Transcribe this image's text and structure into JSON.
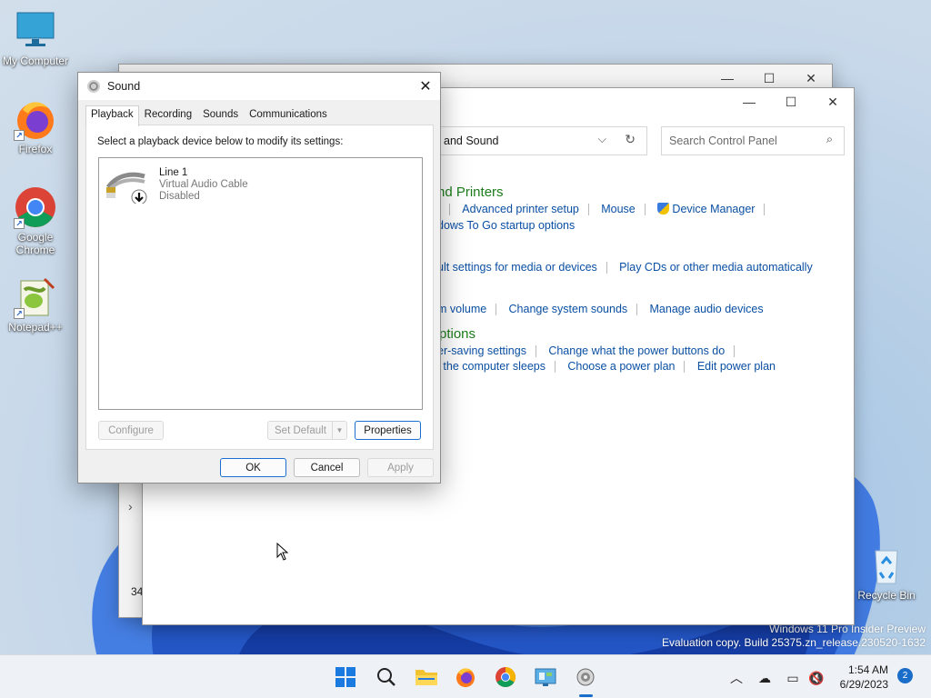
{
  "desktop": {
    "icons": [
      {
        "label": "My Computer",
        "icon": "monitor-icon"
      },
      {
        "label": "Firefox",
        "icon": "firefox-icon"
      },
      {
        "label": "Google Chrome",
        "icon": "chrome-icon"
      },
      {
        "label": "Notepad++",
        "icon": "notepadpp-icon"
      },
      {
        "label": "Recycle Bin",
        "icon": "recycle-bin-icon"
      }
    ],
    "watermark": {
      "line1": "Windows 11 Pro Insider Preview",
      "line2": "Evaluation copy. Build 25375.zn_release.230520-1632"
    }
  },
  "control_panel": {
    "breadcrumb": "and Sound",
    "search_placeholder": "Search Control Panel",
    "status_partial": "34",
    "sections": {
      "devices_heading": "nd Printers",
      "devices_links": [
        "e",
        "Advanced printer setup",
        "Mouse",
        "Device Manager"
      ],
      "devices_links_row2": "dows To Go startup options",
      "autoplay_links": [
        "ult settings for media or devices",
        "Play CDs or other media automatically"
      ],
      "sound_links": [
        "m volume",
        "Change system sounds",
        "Manage audio devices"
      ],
      "power_heading": "ptions",
      "power_links_row1": [
        "er-saving settings",
        "Change what the power buttons do"
      ],
      "power_links_row2": [
        "n the computer sleeps",
        "Choose a power plan",
        "Edit power plan"
      ]
    }
  },
  "sound_dialog": {
    "title": "Sound",
    "tabs": [
      "Playback",
      "Recording",
      "Sounds",
      "Communications"
    ],
    "active_tab": "Playback",
    "instruction": "Select a playback device below to modify its settings:",
    "device": {
      "name": "Line 1",
      "description": "Virtual Audio Cable",
      "status": "Disabled"
    },
    "buttons": {
      "configure": "Configure",
      "set_default": "Set Default",
      "properties": "Properties",
      "ok": "OK",
      "cancel": "Cancel",
      "apply": "Apply"
    }
  },
  "taskbar": {
    "time": "1:54 AM",
    "date": "6/29/2023",
    "notification_count": "2"
  }
}
